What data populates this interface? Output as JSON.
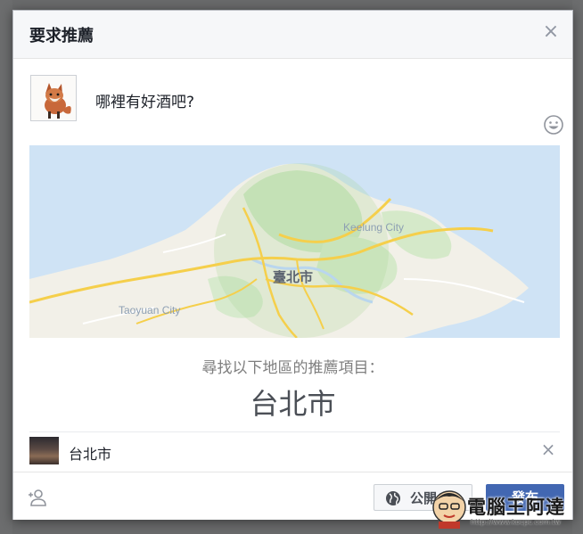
{
  "dialog": {
    "title": "要求推薦"
  },
  "post": {
    "text": "哪裡有好酒吧?",
    "emoji_icon": "smiley-icon"
  },
  "map": {
    "labels": {
      "keelung": "Keelung City",
      "taipei": "臺北市",
      "taoyuan": "Taoyuan City"
    }
  },
  "recommendation": {
    "prompt": "尋找以下地區的推薦項目：",
    "city": "台北市"
  },
  "location": {
    "name": "台北市"
  },
  "footer": {
    "audience_label": "公開",
    "post_label": "發布"
  },
  "watermark": {
    "text": "電腦王阿達",
    "url": "http://www.kocpc.com.tw"
  },
  "colors": {
    "primary": "#4267b2",
    "header_bg": "#f6f7f9",
    "text": "#1d2129"
  }
}
